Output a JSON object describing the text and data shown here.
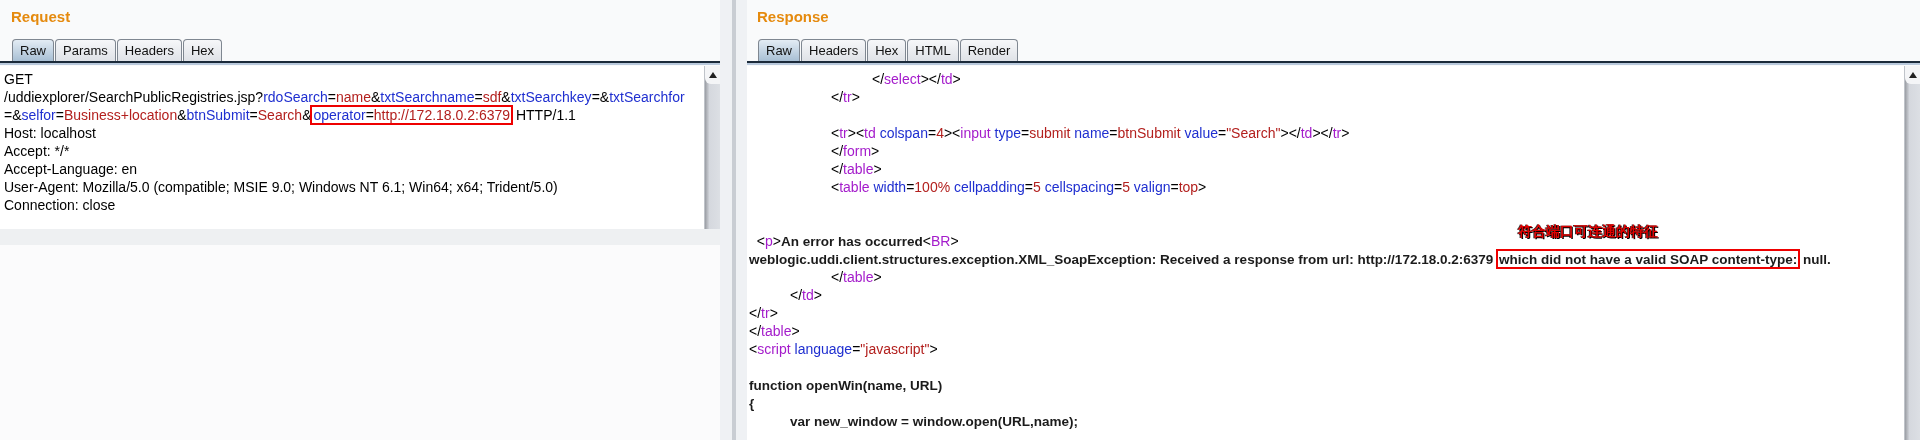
{
  "request": {
    "title": "Request",
    "tabs": [
      {
        "label": "Raw",
        "selected": true
      },
      {
        "label": "Params",
        "selected": false
      },
      {
        "label": "Headers",
        "selected": false
      },
      {
        "label": "Hex",
        "selected": false
      }
    ],
    "lines": [
      {
        "kind": "code",
        "segments": [
          {
            "kind": "plain",
            "text": "GET"
          }
        ]
      },
      {
        "kind": "code",
        "segments": [
          {
            "kind": "plain",
            "text": "/uddiexplorer/SearchPublicRegistries.jsp?"
          },
          {
            "kind": "param",
            "text": "rdoSearch"
          },
          {
            "kind": "plain",
            "text": "="
          },
          {
            "kind": "value",
            "text": "name"
          },
          {
            "kind": "plain",
            "text": "&"
          },
          {
            "kind": "param",
            "text": "txtSearchname"
          },
          {
            "kind": "plain",
            "text": "="
          },
          {
            "kind": "value",
            "text": "sdf"
          },
          {
            "kind": "plain",
            "text": "&"
          },
          {
            "kind": "param",
            "text": "txtSearchkey"
          },
          {
            "kind": "plain",
            "text": "=&"
          },
          {
            "kind": "param",
            "text": "txtSearchfor"
          }
        ]
      },
      {
        "kind": "code",
        "segments": [
          {
            "kind": "plain",
            "text": "=&"
          },
          {
            "kind": "param",
            "text": "selfor"
          },
          {
            "kind": "plain",
            "text": "="
          },
          {
            "kind": "value",
            "text": "Business+location"
          },
          {
            "kind": "plain",
            "text": "&"
          },
          {
            "kind": "param",
            "text": "btnSubmit"
          },
          {
            "kind": "plain",
            "text": "="
          },
          {
            "kind": "value",
            "text": "Search"
          },
          {
            "kind": "plain",
            "text": "&"
          },
          {
            "kind": "box",
            "segments": [
              {
                "kind": "param",
                "text": "operator"
              },
              {
                "kind": "plain",
                "text": "="
              },
              {
                "kind": "value",
                "text": "http://172.18.0.2:6379"
              }
            ]
          },
          {
            "kind": "plain",
            "text": " HTTP/1.1"
          }
        ]
      },
      {
        "kind": "code",
        "segments": [
          {
            "kind": "plain",
            "text": "Host: localhost"
          }
        ]
      },
      {
        "kind": "code",
        "segments": [
          {
            "kind": "plain",
            "text": "Accept: */*"
          }
        ]
      },
      {
        "kind": "code",
        "segments": [
          {
            "kind": "plain",
            "text": "Accept-Language: en"
          }
        ]
      },
      {
        "kind": "code",
        "segments": [
          {
            "kind": "plain",
            "text": "User-Agent: Mozilla/5.0 (compatible; MSIE 9.0; Windows NT 6.1; Win64; x64; Trident/5.0)"
          }
        ]
      },
      {
        "kind": "code",
        "segments": [
          {
            "kind": "plain",
            "text": "Connection: close"
          }
        ]
      }
    ]
  },
  "response": {
    "title": "Response",
    "tabs": [
      {
        "label": "Raw",
        "selected": true
      },
      {
        "label": "Headers",
        "selected": false
      },
      {
        "label": "Hex",
        "selected": false
      },
      {
        "label": "HTML",
        "selected": false
      },
      {
        "label": "Render",
        "selected": false
      }
    ],
    "lines": [
      {
        "kind": "code",
        "segments": [
          {
            "kind": "plain",
            "text": "\t\t\t</"
          },
          {
            "kind": "tag",
            "text": "select"
          },
          {
            "kind": "plain",
            "text": "></"
          },
          {
            "kind": "tag",
            "text": "td"
          },
          {
            "kind": "plain",
            "text": ">"
          }
        ]
      },
      {
        "kind": "code",
        "segments": [
          {
            "kind": "plain",
            "text": "\t\t</"
          },
          {
            "kind": "tag",
            "text": "tr"
          },
          {
            "kind": "plain",
            "text": ">"
          }
        ]
      },
      {
        "kind": "blank"
      },
      {
        "kind": "code",
        "segments": [
          {
            "kind": "plain",
            "text": "\t\t<"
          },
          {
            "kind": "tag",
            "text": "tr"
          },
          {
            "kind": "plain",
            "text": "><"
          },
          {
            "kind": "tag",
            "text": "td"
          },
          {
            "kind": "param",
            "text": " colspan"
          },
          {
            "kind": "plain",
            "text": "="
          },
          {
            "kind": "value",
            "text": "4"
          },
          {
            "kind": "plain",
            "text": "><"
          },
          {
            "kind": "tag",
            "text": "input"
          },
          {
            "kind": "param",
            "text": " type"
          },
          {
            "kind": "plain",
            "text": "="
          },
          {
            "kind": "value",
            "text": "submit"
          },
          {
            "kind": "param",
            "text": " name"
          },
          {
            "kind": "plain",
            "text": "="
          },
          {
            "kind": "value",
            "text": "btnSubmit"
          },
          {
            "kind": "param",
            "text": " value"
          },
          {
            "kind": "plain",
            "text": "="
          },
          {
            "kind": "value",
            "text": "\"Search\""
          },
          {
            "kind": "plain",
            "text": "></"
          },
          {
            "kind": "tag",
            "text": "td"
          },
          {
            "kind": "plain",
            "text": "></"
          },
          {
            "kind": "tag",
            "text": "tr"
          },
          {
            "kind": "plain",
            "text": ">"
          }
        ]
      },
      {
        "kind": "code",
        "segments": [
          {
            "kind": "plain",
            "text": "\t\t</"
          },
          {
            "kind": "tag",
            "text": "form"
          },
          {
            "kind": "plain",
            "text": ">"
          }
        ]
      },
      {
        "kind": "code",
        "segments": [
          {
            "kind": "plain",
            "text": "\t\t</"
          },
          {
            "kind": "tag",
            "text": "table"
          },
          {
            "kind": "plain",
            "text": ">"
          }
        ]
      },
      {
        "kind": "code",
        "segments": [
          {
            "kind": "plain",
            "text": "\t\t<"
          },
          {
            "kind": "tag",
            "text": "table"
          },
          {
            "kind": "param",
            "text": " width"
          },
          {
            "kind": "plain",
            "text": "="
          },
          {
            "kind": "value",
            "text": "100%"
          },
          {
            "kind": "param",
            "text": " cellpadding"
          },
          {
            "kind": "plain",
            "text": "="
          },
          {
            "kind": "value",
            "text": "5"
          },
          {
            "kind": "param",
            "text": " cellspacing"
          },
          {
            "kind": "plain",
            "text": "="
          },
          {
            "kind": "value",
            "text": "5"
          },
          {
            "kind": "param",
            "text": " valign"
          },
          {
            "kind": "plain",
            "text": "="
          },
          {
            "kind": "value",
            "text": "top"
          },
          {
            "kind": "plain",
            "text": ">"
          }
        ]
      },
      {
        "kind": "blank"
      },
      {
        "kind": "blank"
      },
      {
        "kind": "code",
        "segments": [
          {
            "kind": "plain",
            "text": "  <"
          },
          {
            "kind": "tag",
            "text": "p"
          },
          {
            "kind": "plain",
            "text": ">"
          },
          {
            "kind": "bold",
            "text": "An error has occurred"
          },
          {
            "kind": "plain",
            "text": "<"
          },
          {
            "kind": "tag",
            "text": "BR"
          },
          {
            "kind": "plain",
            "text": ">"
          }
        ]
      },
      {
        "kind": "code",
        "segments": [
          {
            "kind": "bold",
            "text": "weblogic.uddi.client.structures.exception.XML_SoapException: Received a response from url: http://172.18.0.2:6379 "
          },
          {
            "kind": "box",
            "segments": [
              {
                "kind": "bold",
                "text": "which did not have a valid SOAP content-type:"
              }
            ]
          },
          {
            "kind": "bold",
            "text": " null."
          }
        ]
      },
      {
        "kind": "code",
        "segments": [
          {
            "kind": "plain",
            "text": "\t\t</"
          },
          {
            "kind": "tag",
            "text": "table"
          },
          {
            "kind": "plain",
            "text": ">"
          }
        ]
      },
      {
        "kind": "code",
        "segments": [
          {
            "kind": "plain",
            "text": "\t</"
          },
          {
            "kind": "tag",
            "text": "td"
          },
          {
            "kind": "plain",
            "text": ">"
          }
        ]
      },
      {
        "kind": "code",
        "segments": [
          {
            "kind": "plain",
            "text": "</"
          },
          {
            "kind": "tag",
            "text": "tr"
          },
          {
            "kind": "plain",
            "text": ">"
          }
        ]
      },
      {
        "kind": "code",
        "segments": [
          {
            "kind": "plain",
            "text": "</"
          },
          {
            "kind": "tag",
            "text": "table"
          },
          {
            "kind": "plain",
            "text": ">"
          }
        ]
      },
      {
        "kind": "code",
        "segments": [
          {
            "kind": "plain",
            "text": "<"
          },
          {
            "kind": "tag",
            "text": "script"
          },
          {
            "kind": "param",
            "text": " language"
          },
          {
            "kind": "plain",
            "text": "="
          },
          {
            "kind": "value",
            "text": "\"javascript\""
          },
          {
            "kind": "plain",
            "text": ">"
          }
        ]
      },
      {
        "kind": "blank"
      },
      {
        "kind": "code",
        "segments": [
          {
            "kind": "bold",
            "text": "function openWin(name, URL)"
          }
        ]
      },
      {
        "kind": "code",
        "segments": [
          {
            "kind": "bold",
            "text": "{"
          }
        ]
      },
      {
        "kind": "code",
        "segments": [
          {
            "kind": "bold",
            "text": "\tvar new_window = window.open(URL,name);"
          }
        ]
      }
    ],
    "annotation": {
      "text": "符合端口可连通的特征"
    }
  }
}
